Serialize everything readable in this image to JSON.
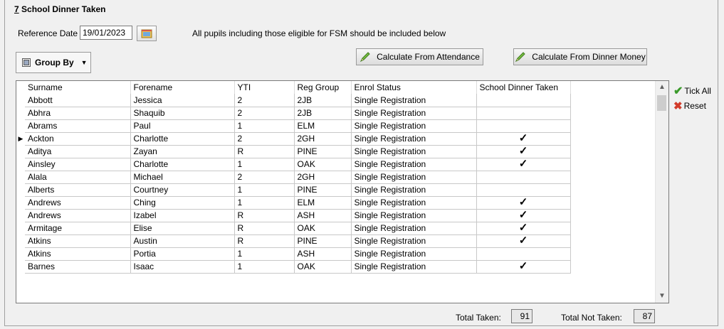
{
  "section": {
    "number": "7",
    "title": "School Dinner Taken"
  },
  "reference_date": {
    "label": "Reference Date",
    "value": "19/01/2023"
  },
  "note": "All pupils including those eligible for FSM should be included below",
  "group_by": {
    "label": "Group By",
    "icon": "grid-icon"
  },
  "buttons": {
    "calc_attendance": "Calculate From Attendance",
    "calc_dinner_money": "Calculate From Dinner Money",
    "tick_all": "Tick All",
    "reset": "Reset"
  },
  "table": {
    "columns": [
      "Surname",
      "Forename",
      "YTI",
      "Reg Group",
      "Enrol Status",
      "School Dinner Taken"
    ],
    "rows": [
      {
        "surname": "Abbott",
        "forename": "Jessica",
        "yti": "2",
        "reg_group": "2JB",
        "enrol_status": "Single Registration",
        "dinner_taken": ""
      },
      {
        "surname": "Abhra",
        "forename": "Shaquib",
        "yti": "2",
        "reg_group": "2JB",
        "enrol_status": "Single Registration",
        "dinner_taken": ""
      },
      {
        "surname": "Abrams",
        "forename": "Paul",
        "yti": "1",
        "reg_group": "ELM",
        "enrol_status": "Single Registration",
        "dinner_taken": ""
      },
      {
        "surname": "Ackton",
        "forename": "Charlotte",
        "yti": "2",
        "reg_group": "2GH",
        "enrol_status": "Single Registration",
        "dinner_taken": "✓"
      },
      {
        "surname": "Aditya",
        "forename": "Zayan",
        "yti": "R",
        "reg_group": "PINE",
        "enrol_status": "Single Registration",
        "dinner_taken": "✓"
      },
      {
        "surname": "Ainsley",
        "forename": "Charlotte",
        "yti": "1",
        "reg_group": "OAK",
        "enrol_status": "Single Registration",
        "dinner_taken": "✓"
      },
      {
        "surname": "Alala",
        "forename": "Michael",
        "yti": "2",
        "reg_group": "2GH",
        "enrol_status": "Single Registration",
        "dinner_taken": ""
      },
      {
        "surname": "Alberts",
        "forename": "Courtney",
        "yti": "1",
        "reg_group": "PINE",
        "enrol_status": "Single Registration",
        "dinner_taken": ""
      },
      {
        "surname": "Andrews",
        "forename": "Ching",
        "yti": "1",
        "reg_group": "ELM",
        "enrol_status": "Single Registration",
        "dinner_taken": "✓"
      },
      {
        "surname": "Andrews",
        "forename": "Izabel",
        "yti": "R",
        "reg_group": "ASH",
        "enrol_status": "Single Registration",
        "dinner_taken": "✓"
      },
      {
        "surname": "Armitage",
        "forename": "Elise",
        "yti": "R",
        "reg_group": "OAK",
        "enrol_status": "Single Registration",
        "dinner_taken": "✓"
      },
      {
        "surname": "Atkins",
        "forename": "Austin",
        "yti": "R",
        "reg_group": "PINE",
        "enrol_status": "Single Registration",
        "dinner_taken": "✓"
      },
      {
        "surname": "Atkins",
        "forename": "Portia",
        "yti": "1",
        "reg_group": "ASH",
        "enrol_status": "Single Registration",
        "dinner_taken": ""
      },
      {
        "surname": "Barnes",
        "forename": "Isaac",
        "yti": "1",
        "reg_group": "OAK",
        "enrol_status": "Single Registration",
        "dinner_taken": "✓"
      }
    ],
    "selected_row_marker": "▶"
  },
  "totals": {
    "taken_label": "Total Taken:",
    "taken_value": "91",
    "not_taken_label": "Total Not Taken:",
    "not_taken_value": "87"
  }
}
